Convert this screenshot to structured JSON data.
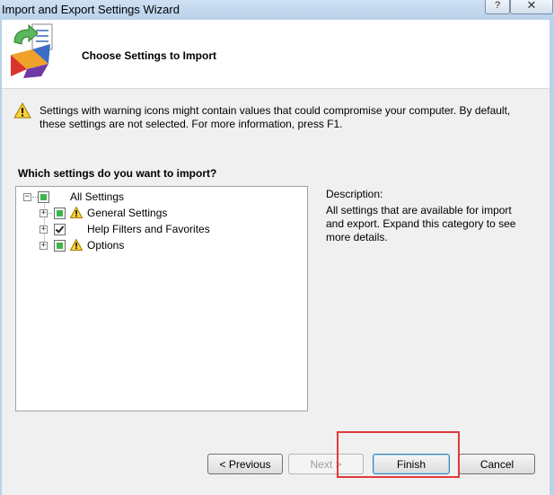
{
  "window": {
    "title": "Import and Export Settings Wizard",
    "help_label": "?",
    "close_label": "✕"
  },
  "header": {
    "title": "Choose Settings to Import"
  },
  "warning": {
    "text": "Settings with warning icons might contain values that could compromise your computer. By default, these settings are not selected. For more information, press F1."
  },
  "settings": {
    "heading": "Which settings do you want to import?",
    "tree": [
      {
        "label": "All Settings",
        "state": "partial",
        "warning": false,
        "expander": "−"
      },
      {
        "label": "General Settings",
        "state": "partial",
        "warning": true,
        "expander": "+"
      },
      {
        "label": "Help Filters and Favorites",
        "state": "checked",
        "warning": false,
        "expander": "+"
      },
      {
        "label": "Options",
        "state": "partial",
        "warning": true,
        "expander": "+"
      }
    ]
  },
  "description": {
    "label": "Description:",
    "text": "All settings that are available for import and export. Expand this category to see more details."
  },
  "buttons": {
    "previous": "< Previous",
    "next": "Next >",
    "finish": "Finish",
    "cancel": "Cancel"
  },
  "colors": {
    "partial_fill": "#3fb64b",
    "highlight_border": "#e03a3a"
  }
}
